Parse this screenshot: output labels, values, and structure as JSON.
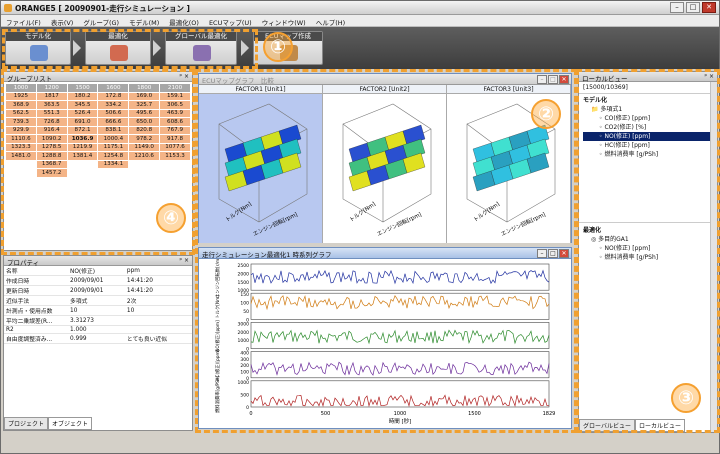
{
  "window": {
    "title": "ORANGE5 [ 20090901-走行シミュレーション ]"
  },
  "menu": [
    "ファイル(F)",
    "表示(V)",
    "グループ(G)",
    "モデル(M)",
    "最適化(O)",
    "ECUマップ(U)",
    "ウィンドウ(W)",
    "ヘルプ(H)"
  ],
  "toolbar": {
    "buttons": [
      {
        "label": "モデル化",
        "icon": "model-icon",
        "color": "#6a8fd0"
      },
      {
        "label": "最適化",
        "icon": "optimize-icon",
        "color": "#d26a50"
      },
      {
        "label": "グローバル最適化",
        "icon": "global-optimize-icon",
        "color": "#8a70b0"
      },
      {
        "label": "ECUマップ作成",
        "icon": "ecu-map-icon",
        "color": "#c08a4a"
      }
    ]
  },
  "callouts": [
    "①",
    "②",
    "③",
    "④"
  ],
  "group_list": {
    "title": "グループリスト",
    "columns": [
      "1000",
      "1200",
      "1500",
      "1600",
      "1800",
      "2100"
    ],
    "rows": [
      [
        "1925",
        "1817",
        "180.2",
        "172.8",
        "169.0",
        "159.1"
      ],
      [
        "368.9",
        "363.5",
        "345.5",
        "334.2",
        "325.7",
        "306.5"
      ],
      [
        "562.5",
        "551.3",
        "526.4",
        "506.6",
        "495.6",
        "463.9"
      ],
      [
        "739.3",
        "726.8",
        "691.0",
        "666.6",
        "650.0",
        "608.6"
      ],
      [
        "929.9",
        "916.4",
        "872.1",
        "838.1",
        "820.8",
        "767.9"
      ],
      [
        "1110.6",
        "1090.2",
        "1036.9",
        "1000.4",
        "978.2",
        "917.8"
      ],
      [
        "1323.3",
        "1278.5",
        "1219.9",
        "1175.1",
        "1149.0",
        "1077.6"
      ],
      [
        "1481.0",
        "1288.8",
        "1381.4",
        "1254.8",
        "1210.6",
        "1153.3"
      ],
      [
        "",
        "1368.7",
        "",
        "1334.1",
        "",
        ""
      ],
      [
        "",
        "1457.2",
        "",
        "",
        "",
        ""
      ]
    ],
    "bold_cell": "1036.9"
  },
  "properties": {
    "title": "プロパティ",
    "rows": [
      [
        "名称",
        "NO(修正)",
        "ppm"
      ],
      [
        "作成日時",
        "2009/09/01",
        "14:41:20"
      ],
      [
        "更新日時",
        "2009/09/01",
        "14:41:20"
      ],
      [
        "近似手法",
        "多項式",
        "2次"
      ],
      [
        "計測点・使用点数",
        "10",
        "10"
      ],
      [
        "平均二乗誤差(R...",
        "3.31273",
        ""
      ],
      [
        "R2",
        "1.000",
        ""
      ],
      [
        "自由度調整済み...",
        "0.999",
        "とても良い近似"
      ]
    ],
    "tabs": [
      "プロジェクト",
      "オブジェクト"
    ]
  },
  "ecu_window": {
    "title": "ECUマップグラフ　比較",
    "factors": [
      "FACTOR1 [Unit1]",
      "FACTOR2 [Unit2]",
      "FACTOR3 [Unit3]"
    ],
    "x_axis": "エンジン回転[rpm]",
    "y_axis": "トルク[Nm]"
  },
  "ts_window": {
    "title": "走行シミュレーション最適化1 時系列グラフ",
    "xlabel": "時間 [秒]",
    "xticks": [
      "0",
      "500",
      "1000",
      "1500",
      "1829"
    ],
    "series": [
      {
        "name": "エンジン回転数[r/m]",
        "color": "#2030a0",
        "ticks": [
          "2500",
          "2000",
          "1500",
          "1000"
        ]
      },
      {
        "name": "トルク[Nm]",
        "color": "#d07a10",
        "ticks": [
          "150",
          "100",
          "50",
          "0"
        ]
      },
      {
        "name": "NO(修正)[ppm]",
        "color": "#2a8a2a",
        "ticks": [
          "3000",
          "2000",
          "1000",
          "0"
        ]
      },
      {
        "name": "HC(修正)[ppm]",
        "color": "#6a2a9a",
        "ticks": [
          "400",
          "300",
          "200",
          "100",
          "0"
        ]
      },
      {
        "name": "燃料消費率[g/PSh]",
        "color": "#b02020",
        "ticks": [
          "1000",
          "500",
          "0"
        ]
      }
    ]
  },
  "local_view": {
    "title": "ローカルビュー",
    "header": "[15000/10369]",
    "model_section": "モデル化",
    "model_tree": [
      "多項式1",
      "CO(修正) [ppm]",
      "CO2(修正) [%]",
      "NO(修正) [ppm]",
      "HC(修正) [ppm]",
      "燃料消費率 [g/PSh]"
    ],
    "opt_section": "最適化",
    "opt_tree": [
      "多目的GA1",
      "NO(修正) [ppm]",
      "燃料消費率 [g/PSh]"
    ],
    "tabs": [
      "グローバルビュー",
      "ローカルビュー"
    ]
  },
  "colors": {
    "accent": "#f0a030",
    "selected": "#0a246a",
    "cell": "#f4b487"
  }
}
